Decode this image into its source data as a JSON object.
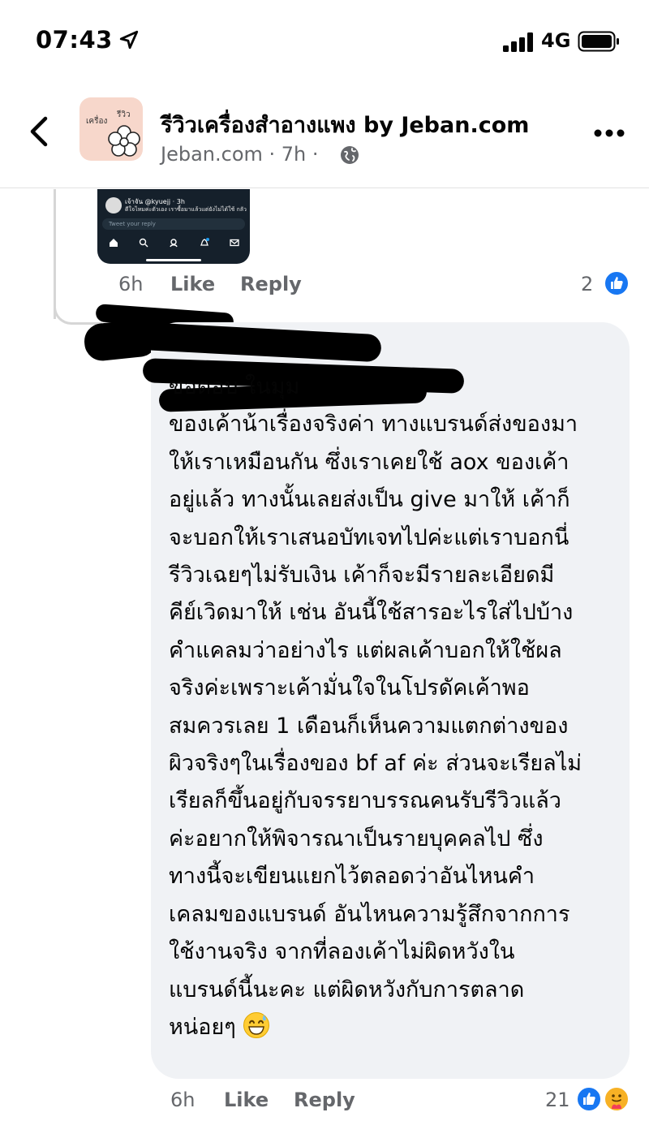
{
  "status_bar": {
    "time": "07:43",
    "network": "4G"
  },
  "header": {
    "page_name": "รีวิวเครื่องสำอางแพง by Jeban.com",
    "page_meta": "Jeban.com · 7h ·",
    "avatar_text_a": "เครื่อง",
    "avatar_text_b": "รีวิว"
  },
  "embedded_screenshot": {
    "author": "เจ้าจัน @kyuejj · 3h",
    "text": "ดีใจไหมค่ะตัวเอง เราซื้อมาแล้วแต่ยังไม่ได้ใช้ กลัว",
    "reply_placeholder": "Tweet your reply"
  },
  "first_comment": {
    "time": "6h",
    "like_label": "Like",
    "reply_label": "Reply",
    "reaction_count": "2"
  },
  "second_comment": {
    "text": "ขอตอบ ในมุม\nของเค้าน้าเรื่องจริงค่า ทางแบรนด์ส่งของมา\nให้เราเหมือนกัน ซึ่งเราเคยใช้ aox ของเค้า\nอยู่แล้ว ทางนั้นเลยส่งเป็น give มาให้ เค้าก็\nจะบอกให้เราเสนอบัทเจทไปค่ะแต่เราบอกนี่\nรีวิวเฉยๆไม่รับเงิน เค้าก็จะมีรายละเอียดมี\nคีย์เวิดมาให้ เช่น อันนี้ใช้สารอะไรใส่ไปบ้าง\nคำแคลมว่าอย่างไร แต่ผลเค้าบอกให้ใช้ผล\nจริงค่ะเพราะเค้ามั่นใจในโปรดัคเค้าพอ\nสมควรเลย  1 เดือนก็เห็นความแตกต่างของ\nผิวจริงๆในเรื่องของ bf af ค่ะ ส่วนจะเรียลไม่\nเรียลก็ขึ้นอยู่กับจรรยาบรรณคนรับรีวิวแล้ว\nค่ะอยากให้พิจารณาเป็นรายบุคคลไป ซึ่ง\nทางนี้จะเขียนแยกไว้ตลอดว่าอันไหนคำ\nเคลมของแบรนด์ อันไหนความรู้สึกจากการ\nใช้งานจริง จากที่ลองเค้าไม่ผิดหวังใน\nแบรนด์นี้นะคะ แต่ผิดหวังกับการตลาด\nหน่อยๆ",
    "time": "6h",
    "like_label": "Like",
    "reply_label": "Reply",
    "reaction_count": "21"
  },
  "colors": {
    "facebook_blue": "#1877f2",
    "secondary_text": "#65676b",
    "bubble_bg": "#f0f2f5"
  }
}
